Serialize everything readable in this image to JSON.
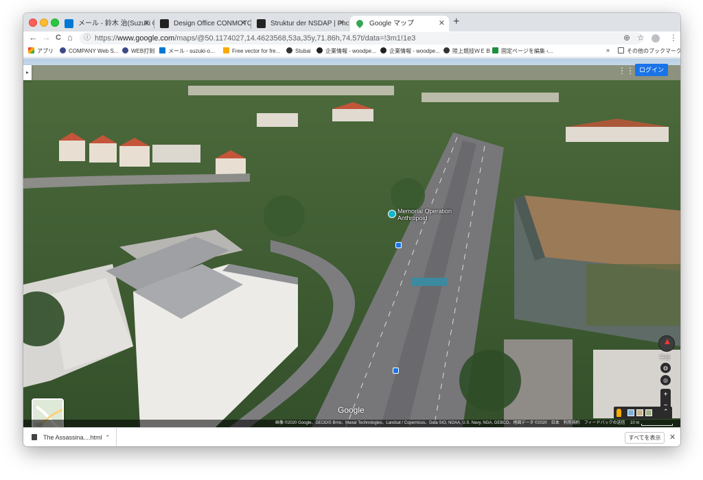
{
  "tabs": [
    {
      "title": "メール - 鈴木 治(Suzuki Osamu)",
      "favicon_color": "#0078d4",
      "active": false
    },
    {
      "title": "Design Office CONMOTO Osamu",
      "favicon_color": "#222222",
      "active": false
    },
    {
      "title": "Struktur der NSDAP | Photogra",
      "favicon_color": "#222222",
      "active": false
    },
    {
      "title": "Google マップ",
      "favicon_color": "#34a853",
      "active": true
    }
  ],
  "toolbar": {
    "back_icon": "←",
    "forward_icon": "→",
    "reload_icon": "C",
    "home_icon": "⌂",
    "url_scheme": "https://",
    "url_host": "www.google.com",
    "url_path": "/maps/@50.1174027,14.4623568,53a,35y,71.86h,74.57t/data=!3m1!1e3",
    "location_icon": "⊕",
    "star_icon": "☆",
    "menu_icon": "⋮"
  },
  "bookmarks": [
    {
      "label": "アプリ",
      "color": "#e8453c"
    },
    {
      "label": "COMPANY Web S...",
      "color": "#3c4a8a"
    },
    {
      "label": "WEB打刻",
      "color": "#3c4a8a"
    },
    {
      "label": "メール - suzuki-o...",
      "color": "#0078d4"
    },
    {
      "label": "Free vector for fre...",
      "color": "#f9ab00"
    },
    {
      "label": "Stubai",
      "color": "#333333"
    },
    {
      "label": "企業情報 - woodpe...",
      "color": "#222222"
    },
    {
      "label": "企業情報 - woodpe...",
      "color": "#222222"
    },
    {
      "label": "陸上競技ＷＥＢ",
      "color": "#333333"
    },
    {
      "label": "固定ページを編集 ‹...",
      "color": "#1e8e3e"
    }
  ],
  "bookmarks_overflow": "»",
  "other_bookmarks": "その他のブックマーク",
  "map": {
    "login_label": "ログイン",
    "poi_name_line1": "Memorial Operation",
    "poi_name_line2": "Anthropoid",
    "minimap_label": "地図",
    "google_label": "Google",
    "tilt_label": "平面",
    "zoom_in": "+",
    "zoom_out": "−",
    "attribution": "画像 ©2020 Google、GEODIS Brno、Maxar Technologies、Landsat / Copernicus、Data SIO, NOAA, U.S. Navy, NGA, GEBCO、地図データ ©2020　日本　利用規約　フィードバックの送信",
    "scale": "10 m"
  },
  "downloads": {
    "filename": "The Assassina....html",
    "show_all": "すべてを表示",
    "close_icon": "✕"
  }
}
